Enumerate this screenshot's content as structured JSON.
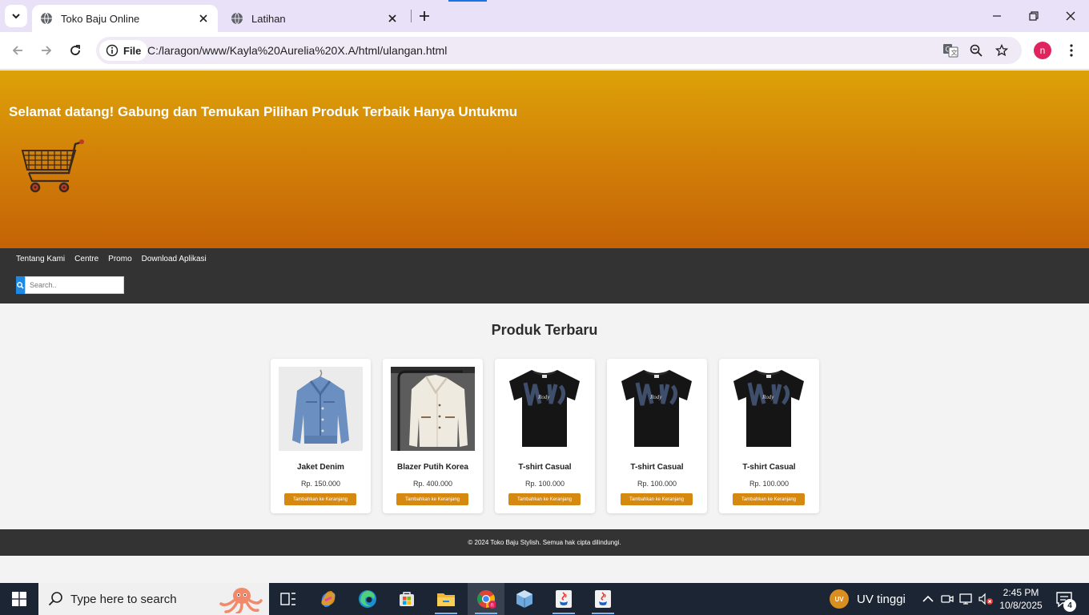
{
  "browser": {
    "tabs": [
      {
        "title": "Toko Baju Online",
        "active": true
      },
      {
        "title": "Latihan",
        "active": false
      }
    ],
    "site_chip": "File",
    "url": "C:/laragon/www/Kayla%20Aurelia%20X.A/html/ulangan.html",
    "profile_initial": "n"
  },
  "hero": {
    "title": "Selamat datang! Gabung dan Temukan Pilihan Produk Terbaik Hanya Untukmu",
    "gradient_colors": [
      "#dda208",
      "#c46306"
    ]
  },
  "nav": {
    "links": [
      "Tentang Kami",
      "Centre",
      "Promo",
      "Download Aplikasi"
    ],
    "search_placeholder": "Search.."
  },
  "section_title": "Produk Terbaru",
  "products": [
    {
      "name": "Jaket Denim",
      "price": "Rp. 150.000",
      "button": "Tambahkan ke Keranjang",
      "image": "denim-jacket"
    },
    {
      "name": "Blazer Putih Korea",
      "price": "Rp. 400.000",
      "button": "Tambahkan ke Keranjang",
      "image": "white-blazer"
    },
    {
      "name": "T-shirt Casual",
      "price": "Rp. 100.000",
      "button": "Tambahkan ke Keranjang",
      "image": "black-tshirt"
    },
    {
      "name": "T-shirt Casual",
      "price": "Rp. 100.000",
      "button": "Tambahkan ke Keranjang",
      "image": "black-tshirt"
    },
    {
      "name": "T-shirt Casual",
      "price": "Rp. 100.000",
      "button": "Tambahkan ke Keranjang",
      "image": "black-tshirt"
    }
  ],
  "footer": "© 2024 Toko Baju Stylish. Semua hak cipta dilindungi.",
  "taskbar": {
    "search_placeholder": "Type here to search",
    "uv_badge": "UV",
    "uv_text": "UV tinggi",
    "time": "2:45 PM",
    "date": "10/8/2025",
    "notification_count": "4"
  },
  "colors": {
    "accent_button": "#d68910",
    "search_button": "#1e88e5",
    "navbar": "#333333"
  }
}
